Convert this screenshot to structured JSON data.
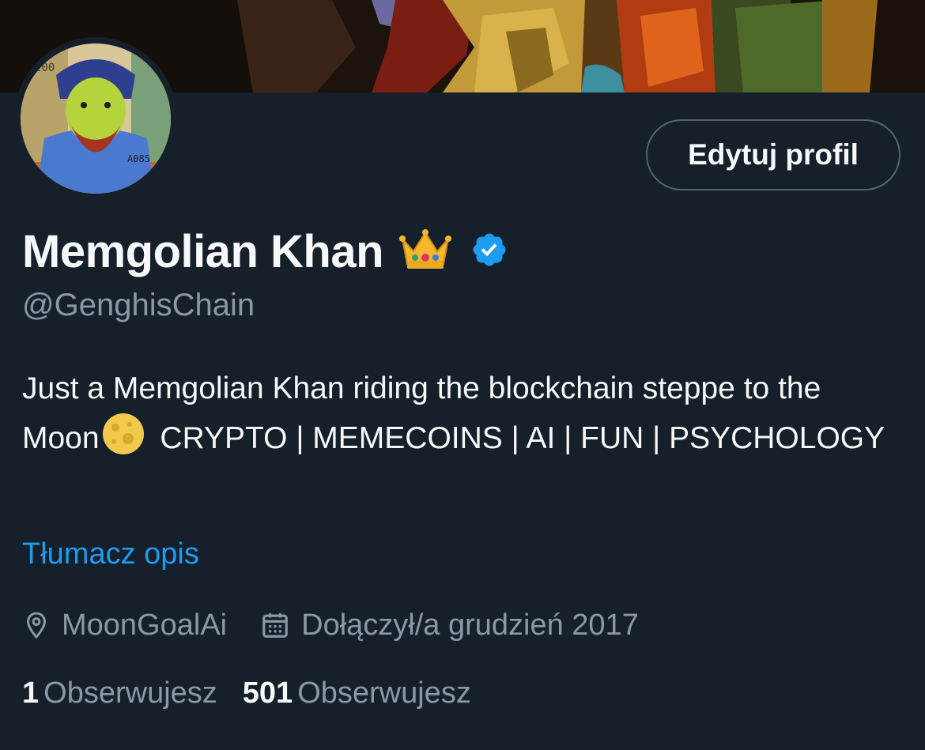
{
  "profile": {
    "display_name": "Memgolian Khan",
    "name_emoji_icon": "crown-icon",
    "verified_icon": "verified-badge-icon",
    "handle": "@GenghisChain",
    "bio_part1": "Just a Memgolian Khan riding the blockchain steppe to the Moon",
    "bio_emoji_icon": "full-moon-icon",
    "bio_part2": " CRYPTO | MEMECOINS | AI | FUN | PSYCHOLOGY",
    "translate_label": "Tłumacz opis",
    "location": "MoonGoalAi",
    "joined": "Dołączył/a grudzień 2017"
  },
  "actions": {
    "edit_profile_label": "Edytuj profil"
  },
  "stats": [
    {
      "count": "1",
      "label": "Obserwujesz"
    },
    {
      "count": "501",
      "label": "Obserwujesz"
    }
  ],
  "colors": {
    "background": "#15202b",
    "primary_text": "#f7f9f9",
    "secondary_text": "#8b98a5",
    "link": "#1d9bf0",
    "verified": "#1d9bf0",
    "button_border": "#536471"
  }
}
